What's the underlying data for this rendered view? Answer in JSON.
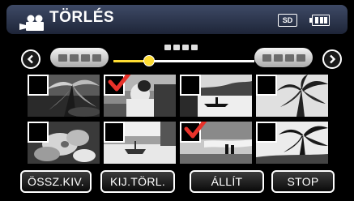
{
  "header": {
    "title": "TÖRLÉS",
    "mode_icon": "video-camera-icon",
    "media_label": "SD",
    "battery_icon": "battery-icon"
  },
  "navigation": {
    "prev_icon": "chevron-left-icon",
    "next_icon": "chevron-right-icon",
    "scroll_position": 0.25
  },
  "thumbnails": [
    {
      "name": "thumb-palm-leaves",
      "selected": false
    },
    {
      "name": "thumb-person-reading",
      "selected": true
    },
    {
      "name": "thumb-canoe-lake",
      "selected": false
    },
    {
      "name": "thumb-palm-tree",
      "selected": false
    },
    {
      "name": "thumb-tropical-flowers",
      "selected": false
    },
    {
      "name": "thumb-beach-boat",
      "selected": false
    },
    {
      "name": "thumb-sunset-couple",
      "selected": true
    },
    {
      "name": "thumb-palm-silhouette",
      "selected": false
    }
  ],
  "buttons": {
    "select_all": "ÖSSZ.KIV.",
    "deselect": "KIJ.TÖRL.",
    "set": "ÁLLÍT",
    "stop": "STOP"
  },
  "colors": {
    "checkmark": "#e8322a",
    "slider_accent": "#ffdd33",
    "header_bg": "#2e3854"
  }
}
